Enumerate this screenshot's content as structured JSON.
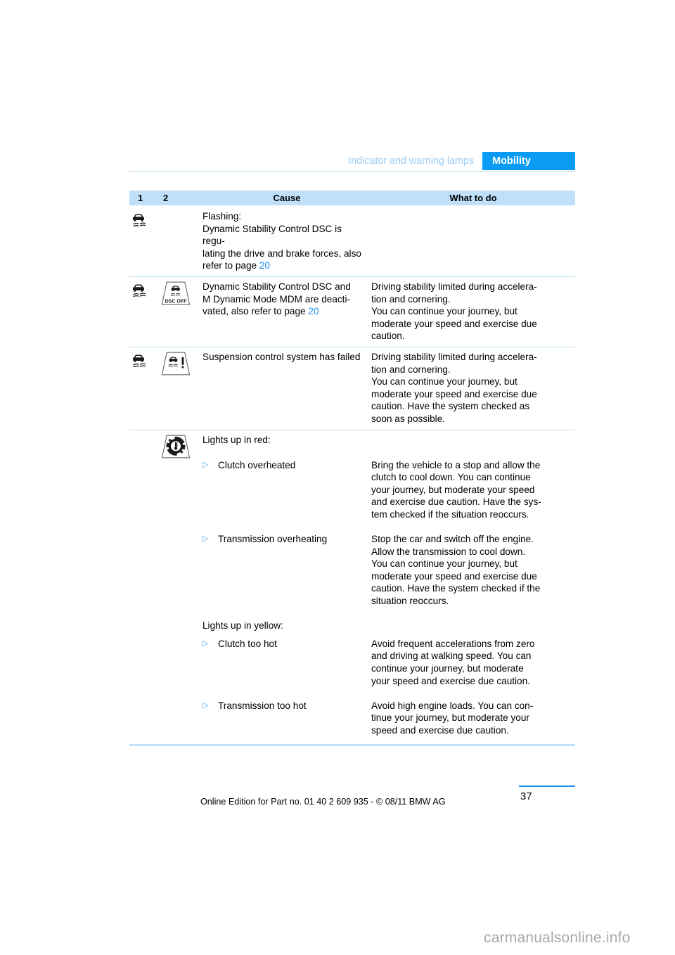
{
  "header": {
    "section": "Indicator and warning lamps",
    "chapter": "Mobility"
  },
  "table": {
    "columns": [
      "1",
      "2",
      "Cause",
      "What to do"
    ],
    "rows": [
      {
        "icon1": "dsc-car-skid-icon",
        "icon2": "",
        "cause_lines": [
          "Flashing:",
          "Dynamic Stability Control DSC is regu-",
          "lating the drive and brake forces, also",
          "refer to page "
        ],
        "cause_ref": "20",
        "what_lines": []
      },
      {
        "icon1": "dsc-car-skid-icon",
        "icon2": "dsc-off-lamp-icon",
        "cause_lines": [
          "Dynamic Stability Control DSC and",
          "M Dynamic Mode MDM are deacti-",
          "vated, also refer to page "
        ],
        "cause_ref": "20",
        "what_lines": [
          "Driving stability limited during accelera-",
          "tion and cornering.",
          "You can continue your journey, but",
          "moderate your speed and exercise due",
          "caution."
        ]
      },
      {
        "icon1": "dsc-car-skid-icon",
        "icon2": "suspension-failure-lamp-icon",
        "cause_lines": [
          "Suspension control system has failed"
        ],
        "cause_ref": "",
        "what_lines": [
          "Driving stability limited during accelera-",
          "tion and cornering.",
          "You can continue your journey, but",
          "moderate your speed and exercise due",
          "caution. Have the system checked as",
          "soon as possible."
        ]
      }
    ],
    "gear_row": {
      "icon2": "gear-temperature-lamp-icon",
      "heading_red": "Lights up in red:",
      "heading_yellow": "Lights up in yellow:",
      "items": [
        {
          "bullet": "▷",
          "cause": "Clutch overheated",
          "what_lines": [
            "Bring the vehicle to a stop and allow the",
            "clutch to cool down. You can continue",
            "your journey, but moderate your speed",
            "and exercise due caution. Have the sys-",
            "tem checked if the situation reoccurs."
          ]
        },
        {
          "bullet": "▷",
          "cause": "Transmission overheating",
          "what_lines": [
            "Stop the car and switch off the engine.",
            "Allow the transmission to cool down.",
            "You can continue your journey, but",
            "moderate your speed and exercise due",
            "caution. Have the system checked if the",
            "situation reoccurs."
          ]
        },
        {
          "bullet": "▷",
          "cause": "Clutch too hot",
          "what_lines": [
            "Avoid frequent accelerations from zero",
            "and driving at walking speed. You can",
            "continue your journey, but moderate",
            "your speed and exercise due caution."
          ]
        },
        {
          "bullet": "▷",
          "cause": "Transmission too hot",
          "what_lines": [
            "Avoid high engine loads. You can con-",
            "tinue your journey, but moderate your",
            "speed and exercise due caution."
          ]
        }
      ]
    }
  },
  "lamp_labels": {
    "dsc_off": "DSC OFF"
  },
  "footer": {
    "note": "Online Edition for Part no. 01 40 2 609 935 - © 08/11 BMW AG",
    "page_number": "37"
  },
  "watermark": "carmanualsonline.info",
  "colors": {
    "accent_blue": "#0a9cf5",
    "header_row_blue": "#bfe0f8",
    "rule_blue": "#bfdff3",
    "link_blue": "#1a8cf0",
    "muted_header": "#9ccdf5"
  }
}
